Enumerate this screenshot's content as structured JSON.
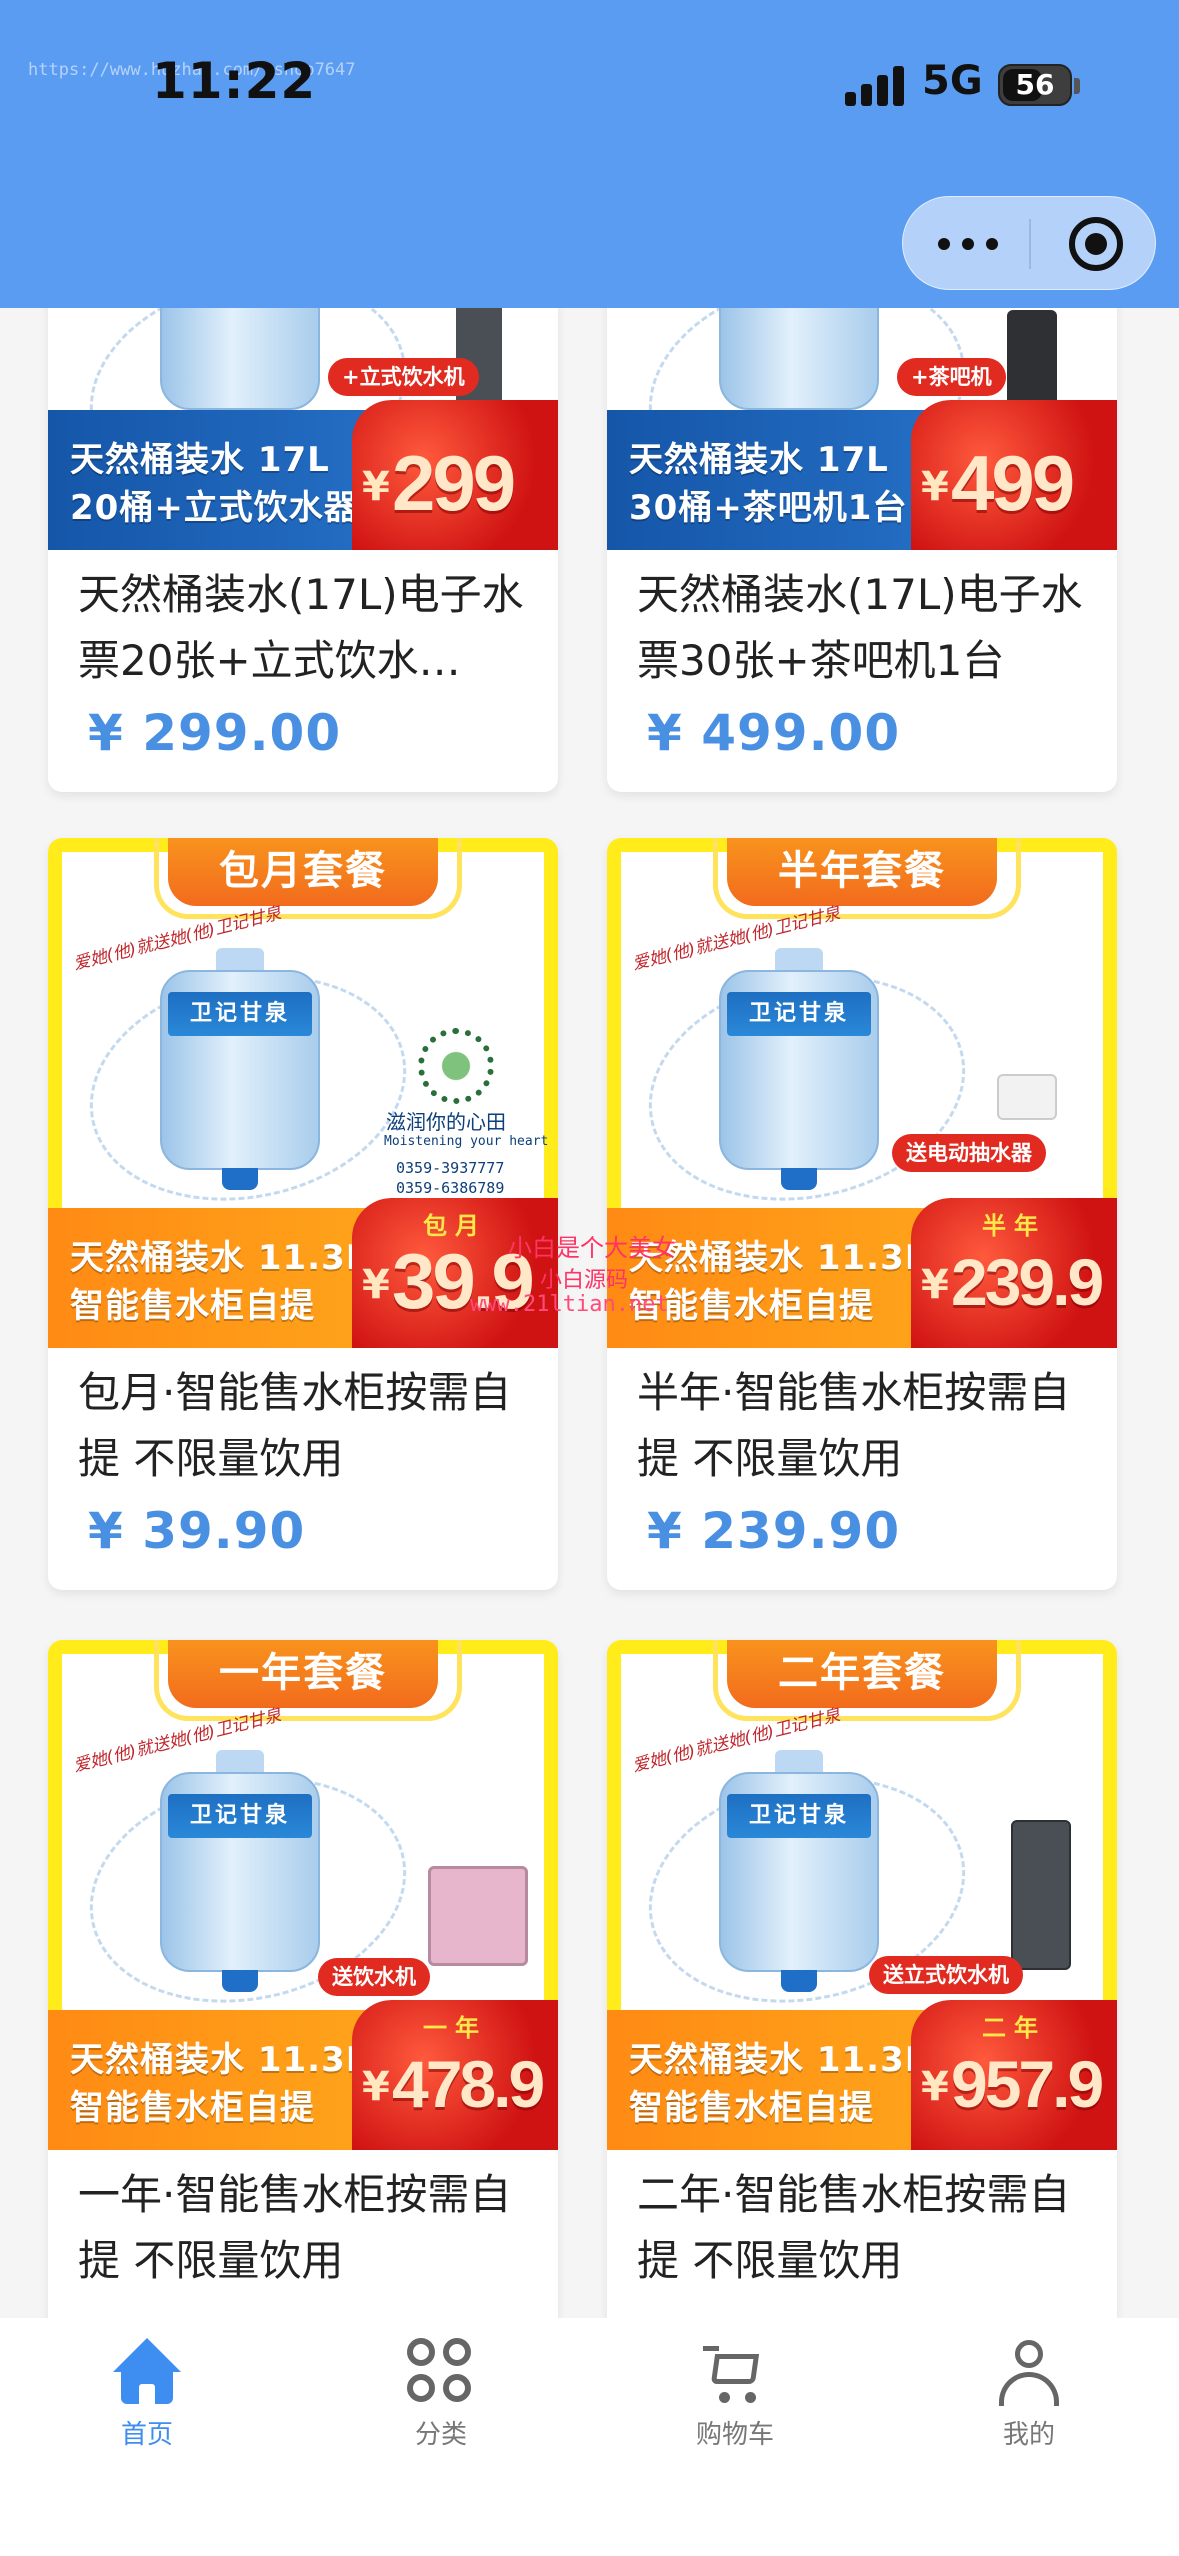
{
  "status_bar": {
    "url_watermark": "https://www.huzhan.com/ishop7647",
    "time": "11:22",
    "network": "5G",
    "battery": "56"
  },
  "products": [
    {
      "poster": {
        "band_line1": "天然桶装水 17L",
        "band_line2": "20桶+立式饮水器1台",
        "price_num": "299",
        "pill": "+立式饮水机"
      },
      "title": "天然桶装水(17L)电子水票20张+立式饮水…",
      "price": "¥ 299.00"
    },
    {
      "poster": {
        "band_line1": "天然桶装水 17L",
        "band_line2": "30桶+茶吧机1台",
        "price_num": "499",
        "pill": "+茶吧机"
      },
      "title": "天然桶装水(17L)电子水票30张+茶吧机1台",
      "price": "¥ 499.00"
    },
    {
      "poster": {
        "ribbon": "包月套餐",
        "slogan": "爱她(他)就送她(他)卫记甘泉",
        "bottle_label": "卫记甘泉",
        "care": "滋润你的心田",
        "care_en": "Moistening your heart",
        "phone1": "0359-3937777",
        "phone2": "0359-6386789",
        "band_line1": "天然桶装水 11.3L",
        "band_line2": "智能售水柜自提",
        "tag": "包月",
        "price_num": "39.9"
      },
      "title": "包月·智能售水柜按需自提 不限量饮用",
      "price": "¥ 39.90"
    },
    {
      "poster": {
        "ribbon": "半年套餐",
        "slogan": "爱她(他)就送她(他)卫记甘泉",
        "bottle_label": "卫记甘泉",
        "pill": "送电动抽水器",
        "band_line1": "天然桶装水 11.3L",
        "band_line2": "智能售水柜自提",
        "tag": "半年",
        "price_num": "239.9"
      },
      "title": "半年·智能售水柜按需自提 不限量饮用",
      "price": "¥ 239.90"
    },
    {
      "poster": {
        "ribbon": "一年套餐",
        "slogan": "爱她(他)就送她(他)卫记甘泉",
        "bottle_label": "卫记甘泉",
        "pill": "送饮水机",
        "band_line1": "天然桶装水 11.3L",
        "band_line2": "智能售水柜自提",
        "tag": "一年",
        "price_num": "478.9"
      },
      "title": "一年·智能售水柜按需自提 不限量饮用"
    },
    {
      "poster": {
        "ribbon": "二年套餐",
        "slogan": "爱她(他)就送她(他)卫记甘泉",
        "bottle_label": "卫记甘泉",
        "pill": "送立式饮水机",
        "band_line1": "天然桶装水 11.3L",
        "band_line2": "智能售水柜自提",
        "tag": "二年",
        "price_num": "957.9"
      },
      "title": "二年·智能售水柜按需自提 不限量饮用"
    }
  ],
  "watermarks": {
    "w1": "小白是个大美女",
    "w2": "小白源码",
    "w3": "www.21ltian.net"
  },
  "tabbar": {
    "home": "首页",
    "category": "分类",
    "cart": "购物车",
    "me": "我的"
  },
  "colors": {
    "header_bg": "#5a9cf2",
    "accent": "#3d8ef0",
    "price": "#4a90e2"
  }
}
